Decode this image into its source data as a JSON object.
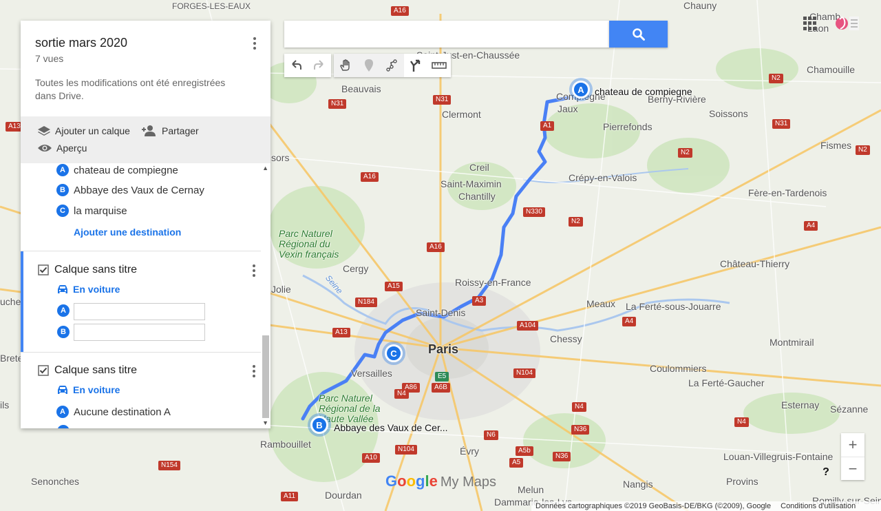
{
  "panel": {
    "title": "sortie mars 2020",
    "views": "7 vues",
    "saved_message": "Toutes les modifications ont été enregistrées dans Drive.",
    "actions": {
      "add_layer": "Ajouter un calque",
      "share": "Partager",
      "preview": "Aperçu"
    },
    "route_layer": {
      "destinations": [
        {
          "letter": "A",
          "name": "chateau de compiegne"
        },
        {
          "letter": "B",
          "name": "Abbaye des Vaux de Cernay"
        },
        {
          "letter": "C",
          "name": "la marquise"
        }
      ],
      "add_destination": "Ajouter une destination"
    },
    "layers": [
      {
        "title": "Calque sans titre",
        "mode": "En voiture",
        "inputs": [
          {
            "letter": "A",
            "value": "",
            "placeholder": ""
          },
          {
            "letter": "B",
            "value": "",
            "placeholder": ""
          }
        ]
      },
      {
        "title": "Calque sans titre",
        "mode": "En voiture",
        "destinations": [
          {
            "letter": "A",
            "name": "Aucune destination A"
          }
        ]
      }
    ]
  },
  "search": {
    "value": "",
    "placeholder": ""
  },
  "toolbar": {
    "icons": [
      "undo-icon",
      "redo-icon",
      "hand-icon",
      "marker-icon",
      "draw-line-icon",
      "directions-icon",
      "ruler-icon"
    ]
  },
  "map": {
    "markers": [
      {
        "letter": "A",
        "label": "chateau de compiegne"
      },
      {
        "letter": "B",
        "label": "Abbaye des Vaux de Cer..."
      },
      {
        "letter": "C",
        "label": ""
      }
    ],
    "places": {
      "forges": "FORGES-LES-EAUX",
      "chauny": "Chauny",
      "chambry": "Chamb",
      "laon": "Laon",
      "saint_just": "Saint-Just-en-Chaussée",
      "chamouille": "Chamouille",
      "beauvais": "Beauvais",
      "compiegne": "Compiègne",
      "jaux": "Jaux",
      "berny": "Berny-Rivière",
      "soissons": "Soissons",
      "clermont": "Clermont",
      "pierrefonds": "Pierrefonds",
      "fismes": "Fismes",
      "sors": "sors",
      "creil": "Creil",
      "saint_maximin": "Saint-Maximin",
      "chantilly": "Chantilly",
      "crepy": "Crépy-en-Valois",
      "fere": "Fère-en-Tardenois",
      "park_vexin": "Parc Naturel Régional du Vexin français",
      "cergy": "Cergy",
      "chateau_thierry": "Château-Thierry",
      "roissy": "Roissy-en-France",
      "jolie": "Jolie",
      "seine": "Seine",
      "meaux": "Meaux",
      "ferte_jouarre": "La Ferté-sous-Jouarre",
      "uches": "uches",
      "saint_denis": "Saint-Denis",
      "paris": "Paris",
      "chessy": "Chessy",
      "brete": "Brete",
      "montmirail": "Montmirail",
      "versailles": "Versailles",
      "coulommiers": "Coulommiers",
      "ferte_gaucher": "La Ferté-Gaucher",
      "park_chevreuse": "Parc Naturel Régional de la Haute Vallée",
      "ils": "ils",
      "esternay": "Esternay",
      "sezanne": "Sézanne",
      "rambouillet": "Rambouillet",
      "evry": "Évry",
      "louan": "Louan-Villegruis-Fontaine",
      "senonches": "Senonches",
      "nangis": "Nangis",
      "provins": "Provins",
      "dourdan": "Dourdan",
      "melun": "Melun",
      "dammarie": "Dammarie-les-Lys",
      "romilly": "Romilly-sur-Seine"
    },
    "roads": [
      "A16",
      "N31",
      "N2",
      "A13",
      "N31",
      "A1",
      "N2",
      "A16",
      "N330",
      "N2",
      "N31",
      "A4",
      "N2",
      "A16",
      "A15",
      "N184",
      "A3",
      "A13",
      "A104",
      "A4",
      "E5",
      "A86",
      "A6B",
      "N104",
      "N4",
      "N36",
      "N4",
      "N6",
      "A5b",
      "N104",
      "A10",
      "A5",
      "N36",
      "N154",
      "A11",
      "N4"
    ]
  },
  "colors": {
    "route": "#4a80f5",
    "accent": "#1a73e8",
    "search_button": "#4285f4",
    "road_badge": "#c0392b"
  },
  "logo": {
    "google": "Google",
    "product": "My Maps"
  },
  "footer": {
    "attribution": "Données cartographiques ©2019 GeoBasis-DE/BKG (©2009), Google",
    "terms": "Conditions d'utilisation"
  },
  "zoom": {
    "in": "+",
    "out": "−"
  },
  "help": "?"
}
